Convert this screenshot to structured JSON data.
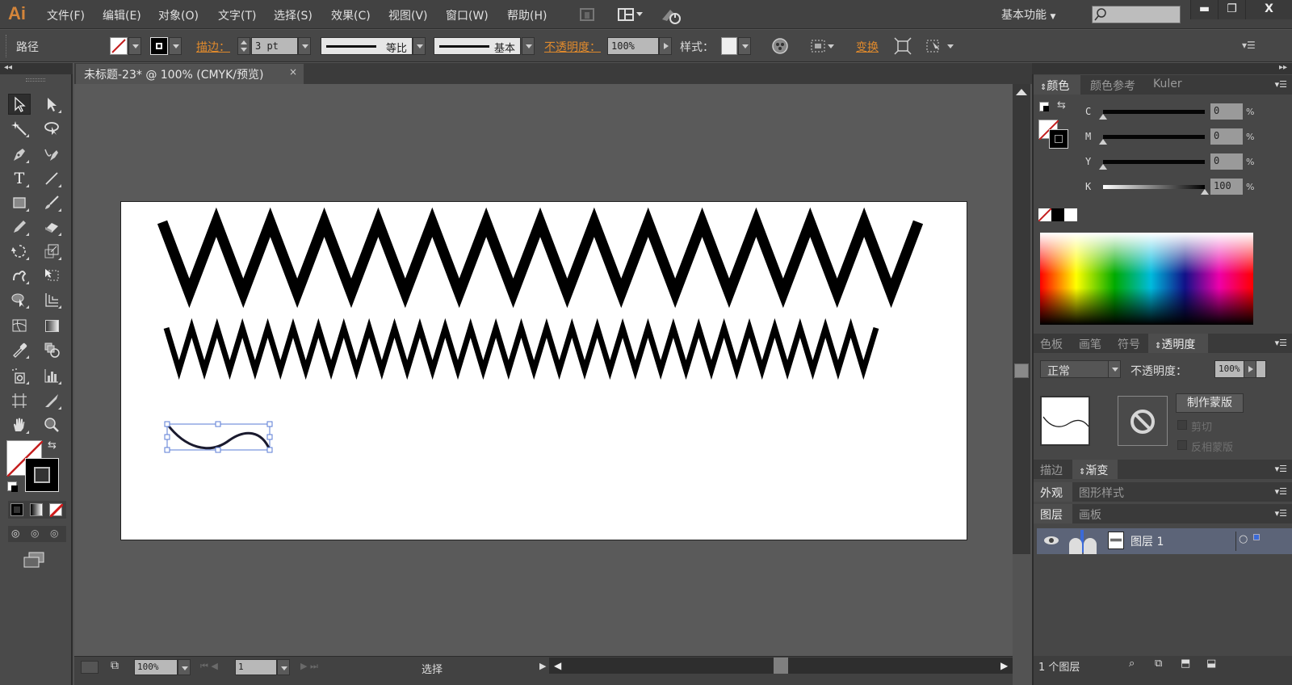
{
  "app": {
    "logo": "Ai",
    "workspace": "基本功能",
    "search_placeholder": ""
  },
  "menu": [
    "文件(F)",
    "编辑(E)",
    "对象(O)",
    "文字(T)",
    "选择(S)",
    "效果(C)",
    "视图(V)",
    "窗口(W)",
    "帮助(H)"
  ],
  "window_controls": {
    "minimize": "▬",
    "restore": "❐",
    "close": "X"
  },
  "controlbar": {
    "selection_type": "路径",
    "stroke_label": "描边：",
    "stroke_weight": "3 pt",
    "variable_width_profile": "等比",
    "brush_definition": "基本",
    "opacity_label": "不透明度：",
    "opacity_value": "100%",
    "style_label": "样式：",
    "transform_label": "变换"
  },
  "document": {
    "tab_title": "未标题-23* @ 100% (CMYK/预览)",
    "close": "×"
  },
  "artwork": {
    "zigzag_large": {
      "peaks": 14,
      "stroke": "#000000"
    },
    "zigzag_small": {
      "peaks": 28,
      "stroke": "#000000"
    },
    "selected_path": {
      "type": "wave",
      "stroke": "#1a1a2e"
    }
  },
  "color_panel": {
    "tabs": [
      "颜色",
      "颜色参考",
      "Kuler"
    ],
    "active_tab": "颜色",
    "channels": [
      {
        "label": "C",
        "value": "0",
        "fraction": 0.0
      },
      {
        "label": "M",
        "value": "0",
        "fraction": 0.0
      },
      {
        "label": "Y",
        "value": "0",
        "fraction": 0.0
      },
      {
        "label": "K",
        "value": "100",
        "fraction": 1.0
      }
    ],
    "unit": "%"
  },
  "transparency_panel": {
    "tabs": [
      "色板",
      "画笔",
      "符号",
      "透明度"
    ],
    "active_tab": "透明度",
    "blend_mode": "正常",
    "opacity_label": "不透明度：",
    "opacity_value": "100%",
    "make_mask_button": "制作蒙版",
    "clip_label": "剪切",
    "invert_mask_label": "反相蒙版"
  },
  "stroke_panel": {
    "tabs": [
      "描边",
      "渐变"
    ],
    "active_tab": "渐变"
  },
  "appearance_panel": {
    "tabs": [
      "外观",
      "图形样式"
    ],
    "active_tab": "外观"
  },
  "layers_panel": {
    "tabs": [
      "图层",
      "画板"
    ],
    "active_tab": "图层",
    "layers": [
      {
        "name": "图层 1"
      }
    ],
    "footer_count": "1 个图层"
  },
  "statusbar": {
    "zoom": "100%",
    "artboard_number": "1",
    "tool_status": "选择"
  },
  "colors": {
    "accent_orange": "#e08a2c",
    "panel_bg": "#474747",
    "canvas_bg": "#5a5a5a",
    "artboard": "#ffffff"
  }
}
